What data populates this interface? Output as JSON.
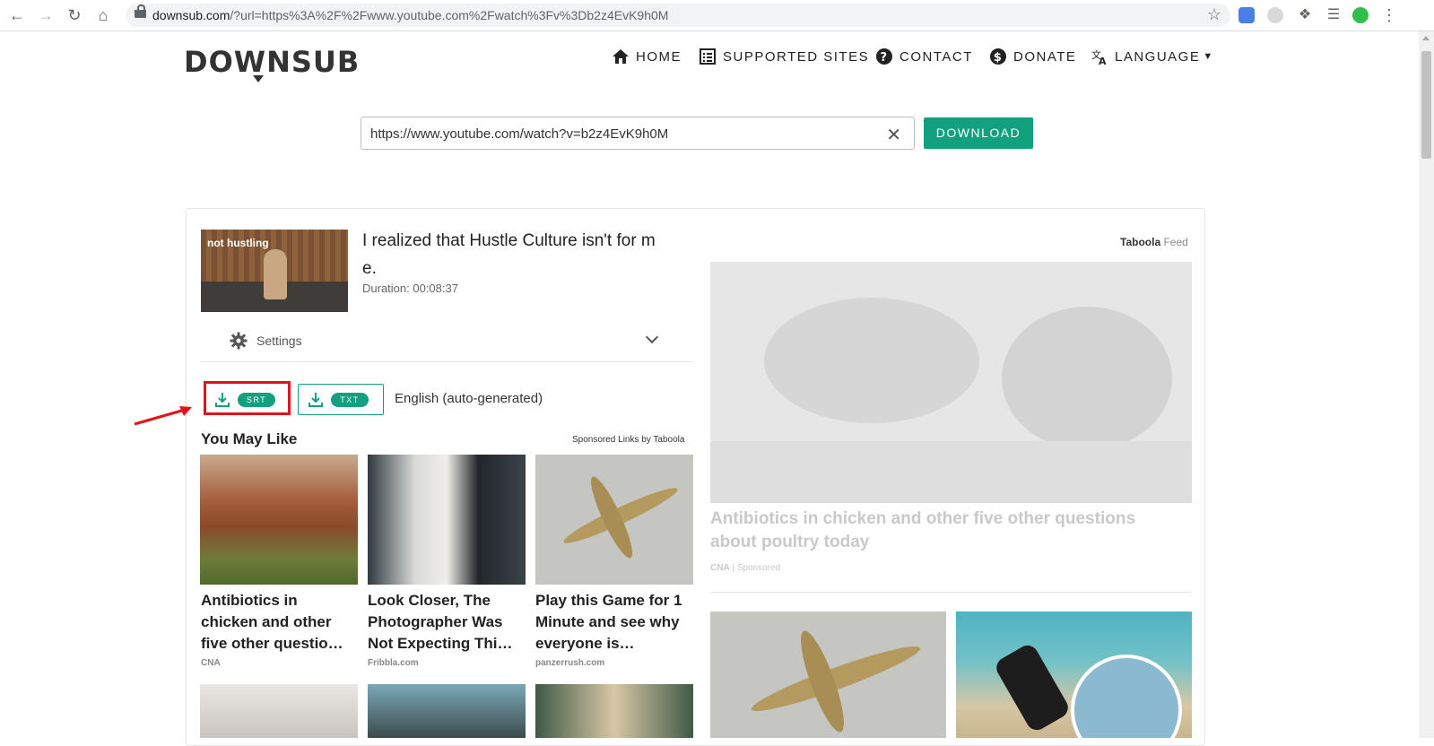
{
  "browser": {
    "url_host": "downsub.com",
    "url_rest": "/?url=https%3A%2F%2Fwww.youtube.com%2Fwatch%3Fv%3Db2z4EvK9h0M"
  },
  "site": {
    "logo": "DOWNSUB",
    "nav": [
      {
        "label": "HOME",
        "icon": "home-icon"
      },
      {
        "label": "SUPPORTED SITES",
        "icon": "list-icon"
      },
      {
        "label": "CONTACT",
        "icon": "question-icon"
      },
      {
        "label": "DONATE",
        "icon": "dollar-icon"
      },
      {
        "label": "LANGUAGE",
        "icon": "translate-icon"
      }
    ]
  },
  "search": {
    "value": "https://www.youtube.com/watch?v=b2z4EvK9h0M",
    "button": "DOWNLOAD"
  },
  "video": {
    "thumb_tag": "not hustling",
    "title_line1": "I realized that Hustle Culture isn't for m",
    "title_line2": "e.",
    "duration": "Duration: 00:08:37",
    "settings_label": "Settings"
  },
  "formats": {
    "srt": "SRT",
    "txt": "TXT",
    "language": "English (auto-generated)"
  },
  "recommend": {
    "heading": "You May Like",
    "sponsored": "Sponsored Links by Taboola",
    "tiles": [
      {
        "title1": "Antibiotics in",
        "title2": "chicken and other",
        "title3": "five other questio…",
        "source": "CNA"
      },
      {
        "title1": "Look Closer, The",
        "title2": "Photographer Was",
        "title3": "Not Expecting Thi…",
        "source": "Fribbla.com"
      },
      {
        "title1": "Play this Game for 1",
        "title2": "Minute and see why",
        "title3": "everyone is…",
        "source": "panzerrush.com"
      }
    ]
  },
  "feed": {
    "brand": "Taboola",
    "feed_label": "Feed",
    "big_title1": "Antibiotics in chicken and other five other questions",
    "big_title2": "about poultry today",
    "big_source": "CNA",
    "big_sponsored": "Sponsored"
  },
  "colors": {
    "accent": "#13a07e",
    "highlight": "#e0141c"
  }
}
